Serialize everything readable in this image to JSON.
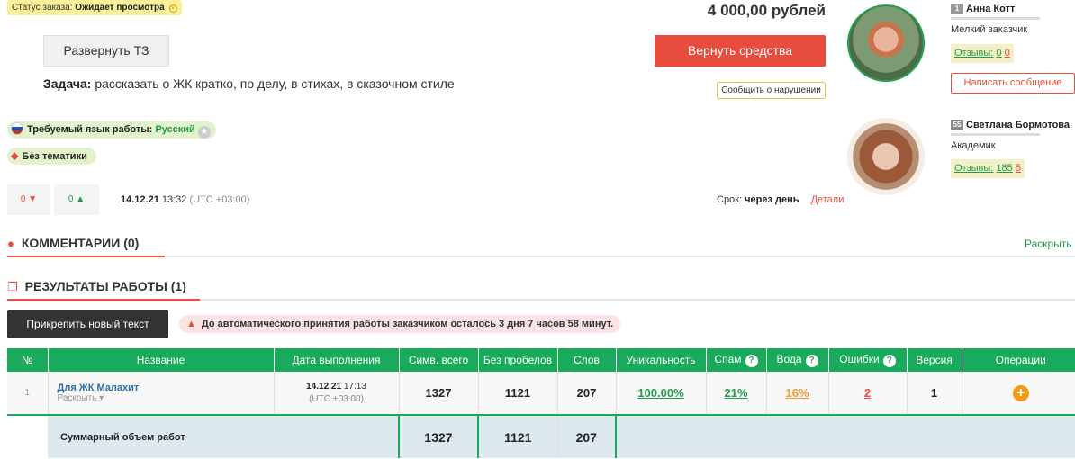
{
  "order": {
    "status_label": "Статус заказа:",
    "status_value": "Ожидает просмотра",
    "price": "4 000,00 рублей",
    "expand_tz_label": "Развернуть ТЗ",
    "task_label": "Задача:",
    "task_text": "рассказать о ЖК кратко, по делу, в стихах, в сказочном стиле",
    "refund_label": "Вернуть средства",
    "report_label": "Сообщить о нарушении",
    "language_label": "Требуемый язык работы:",
    "language_value": "Русский",
    "topic_label": "Без тематики",
    "votes_down": "0",
    "votes_up": "0",
    "date": "14.12.21",
    "time": "13:32",
    "timezone": "(UTC +03:00)",
    "deadline_label": "Срок:",
    "deadline_value": "через день",
    "details_label": "Детали"
  },
  "customer": {
    "level": "1",
    "name": "Анна Котт",
    "role": "Мелкий заказчик",
    "reviews_label": "Отзывы:",
    "reviews_pos": "0",
    "reviews_neg": "0",
    "message_label": "Написать сообщение"
  },
  "author": {
    "level": "55",
    "name": "Светлана Бормотова",
    "role": "Академик",
    "reviews_label": "Отзывы:",
    "reviews_pos": "185",
    "reviews_neg": "5"
  },
  "comments": {
    "title": "КОММЕНТАРИИ (0)",
    "expand_label": "Раскрыть"
  },
  "results": {
    "title": "РЕЗУЛЬТАТЫ РАБОТЫ (1)",
    "attach_label": "Прикрепить новый текст",
    "notice": "До автоматического принятия работы заказчиком осталось 3 дня 7 часов 58 минут."
  },
  "table": {
    "headers": [
      "№",
      "Название",
      "Дата выполнения",
      "Симв. всего",
      "Без пробелов",
      "Слов",
      "Уникальность",
      "Спам",
      "Вода",
      "Ошибки",
      "Версия",
      "Операции"
    ],
    "row": {
      "num": "1",
      "title": "Для ЖК Малахит",
      "expand": "Раскрыть",
      "date": "14.12.21",
      "time": "17:13",
      "tz": "(UTC +03:00)",
      "chars": "1327",
      "no_spaces": "1121",
      "words": "207",
      "uniqueness": "100.00%",
      "spam": "21%",
      "water": "16%",
      "errors": "2",
      "version": "1"
    },
    "summary": {
      "label": "Суммарный объем работ",
      "chars": "1327",
      "no_spaces": "1121",
      "words": "207"
    }
  },
  "colors": {
    "accent_red": "#e84c3d",
    "accent_green": "#1aaa5c",
    "status_yellow": "#f9ef9a"
  }
}
